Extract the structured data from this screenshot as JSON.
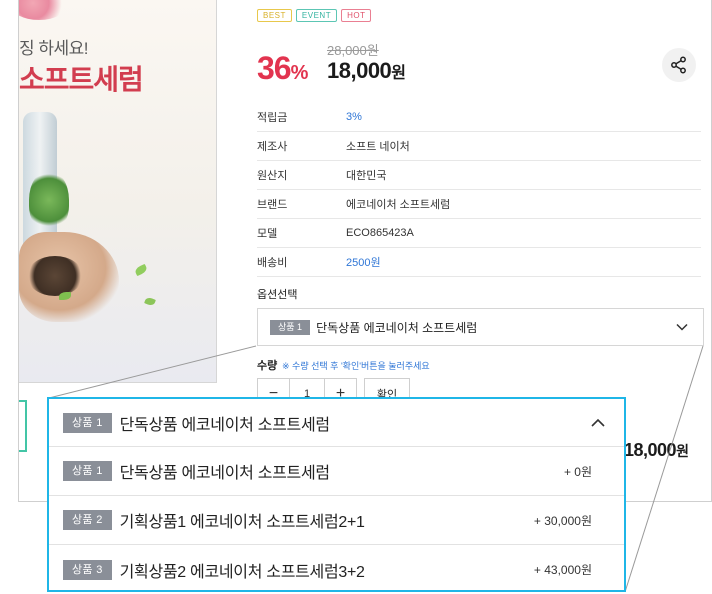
{
  "hero": {
    "copy_line1": "징 하세요!",
    "copy_line2": "소프트세럼"
  },
  "badges": [
    {
      "label": "BEST",
      "color": "#e8c84c"
    },
    {
      "label": "EVENT",
      "color": "#5cc6b4"
    },
    {
      "label": "HOT",
      "color": "#ea7f92"
    }
  ],
  "pricing": {
    "original_price": "28,000원",
    "discount_value": "36",
    "discount_unit": "%",
    "sale_price_value": "18,000",
    "sale_price_unit": "원"
  },
  "share": {
    "icon": "share-icon"
  },
  "info_rows": [
    {
      "label": "적립금",
      "value": "3%",
      "highlight": true
    },
    {
      "label": "제조사",
      "value": "소프트 네이처",
      "highlight": false
    },
    {
      "label": "원산지",
      "value": "대한민국",
      "highlight": false
    },
    {
      "label": "브랜드",
      "value": "에코네이처 소프트세럼",
      "highlight": false
    },
    {
      "label": "모델",
      "value": "ECO865423A",
      "highlight": false
    },
    {
      "label": "배송비",
      "value": "2500원",
      "highlight": true
    }
  ],
  "option": {
    "title": "옵션선택",
    "selected_tag": "상품 1",
    "selected_label": "단독상품 에코네이처 소프트세럼"
  },
  "quantity": {
    "label": "수량",
    "hint": "※ 수량 선택 후 '확인'버튼을 눌러주세요",
    "minus": "−",
    "value": "1",
    "plus": "+",
    "confirm": "확인"
  },
  "total": {
    "value": "18,000",
    "unit": "원"
  },
  "dropdown": {
    "head_tag": "상품 1",
    "head_label": "단독상품 에코네이처 소프트세럼",
    "items": [
      {
        "tag": "상품 1",
        "label": "단독상품 에코네이처 소프트세럼",
        "price": "+ 0원"
      },
      {
        "tag": "상품 2",
        "label": "기획상품1 에코네이처 소프트세럼2+1",
        "price": "+ 30,000원"
      },
      {
        "tag": "상품 3",
        "label": "기획상품2 에코네이처 소프트세럼3+2",
        "price": "+ 43,000원"
      }
    ]
  },
  "colors": {
    "accent_red": "#e2344f",
    "link_blue": "#2f76d6",
    "highlight_frame": "#1fb6e7",
    "tag_gray": "#8a8f98"
  }
}
